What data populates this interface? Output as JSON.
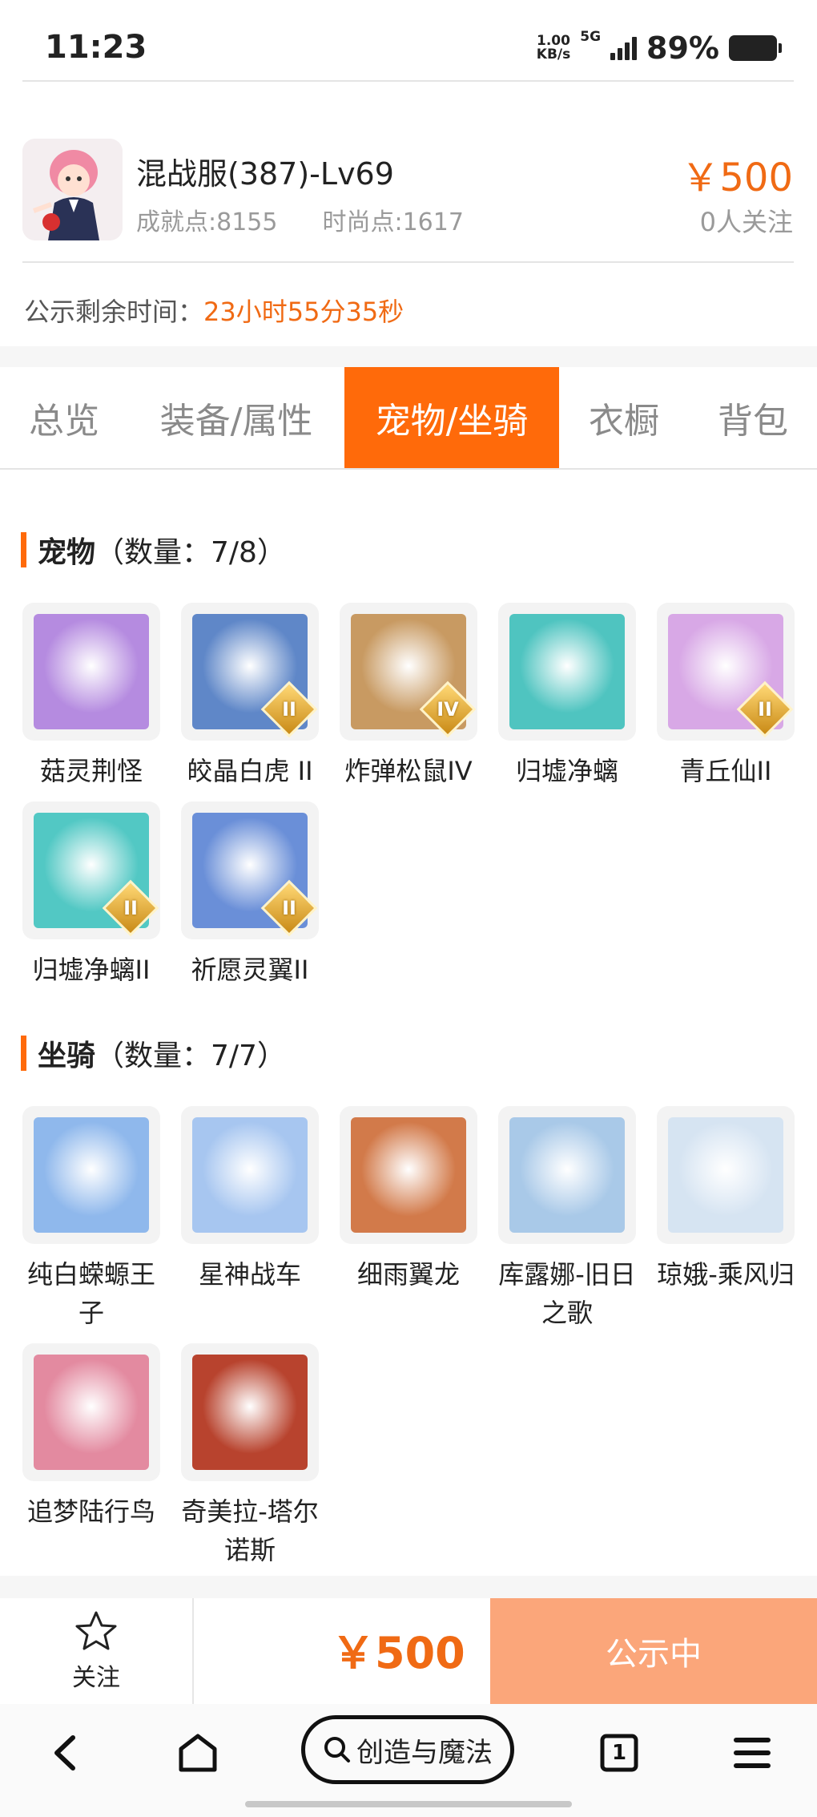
{
  "status_bar": {
    "time": "11:23",
    "speed_value": "1.00",
    "speed_unit": "KB/s",
    "network": "5G",
    "battery": "89%"
  },
  "account": {
    "title": "混战服(387)-Lv69",
    "achievement": "成就点:8155",
    "fashion": "时尚点:1617",
    "price": "￥500",
    "followers": "0人关注"
  },
  "timer": {
    "label": "公示剩余时间：",
    "value": "23小时55分35秒"
  },
  "tabs": [
    {
      "label": "总览",
      "active": false
    },
    {
      "label": "装备/属性",
      "active": false
    },
    {
      "label": "宠物/坐骑",
      "active": true
    },
    {
      "label": "衣橱",
      "active": false
    },
    {
      "label": "背包",
      "active": false
    }
  ],
  "pets": {
    "title": "宠物",
    "count": "（数量：7/8）",
    "items": [
      {
        "name": "菇灵荆怪",
        "badge": "",
        "color": "#b58be0"
      },
      {
        "name": "皎晶白虎 II",
        "badge": "II",
        "color": "#5f87c8"
      },
      {
        "name": "炸弹松鼠IV",
        "badge": "IV",
        "color": "#c89a62"
      },
      {
        "name": "归墟净螭",
        "badge": "",
        "color": "#4fc4c0"
      },
      {
        "name": "青丘仙II",
        "badge": "II",
        "color": "#d8a8e6"
      },
      {
        "name": "归墟净螭II",
        "badge": "II",
        "color": "#52c8c4"
      },
      {
        "name": "祈愿灵翼II",
        "badge": "II",
        "color": "#6a8fd8"
      }
    ]
  },
  "mounts": {
    "title": "坐骑",
    "count": "（数量：7/7）",
    "items": [
      {
        "name": "纯白蝾螈王子",
        "color": "#8fb8ec"
      },
      {
        "name": "星神战车",
        "color": "#a7c6f0"
      },
      {
        "name": "细雨翼龙",
        "color": "#d27a4a"
      },
      {
        "name": "库露娜-旧日之歌",
        "color": "#a9c9e8"
      },
      {
        "name": "琼娥-乘风归",
        "color": "#d6e4f2"
      },
      {
        "name": "追梦陆行鸟",
        "color": "#e38aa0"
      },
      {
        "name": "奇美拉-塔尔诺斯",
        "color": "#b8432e"
      }
    ]
  },
  "bottom_bar": {
    "follow_label": "关注",
    "price": "￥500",
    "action": "公示中"
  },
  "browser_nav": {
    "search_text": "创造与魔法",
    "tab_count": "1"
  }
}
